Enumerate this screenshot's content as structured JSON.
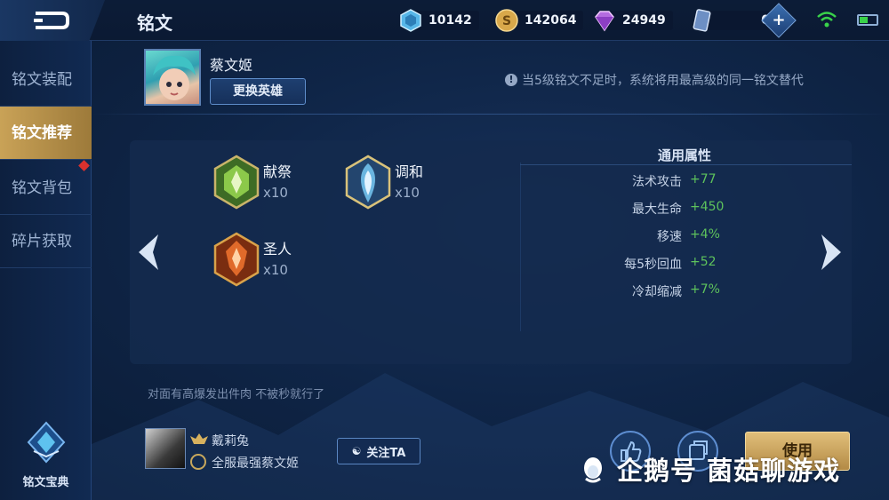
{
  "header": {
    "page_title": "铭文",
    "resources": {
      "gem": "10142",
      "coin": "142064",
      "diamond": "24949",
      "ticket": "0"
    }
  },
  "sidebar": {
    "items": [
      {
        "label": "铭文装配"
      },
      {
        "label": "铭文推荐"
      },
      {
        "label": "铭文背包"
      },
      {
        "label": "碎片获取"
      }
    ],
    "codex_label": "铭文宝典"
  },
  "hero": {
    "name": "蔡文姬",
    "change_button": "更换英雄",
    "notice": "当5级铭文不足时，系统将用最高级的同一铭文替代"
  },
  "runes": [
    {
      "name": "献祭",
      "count": "x10",
      "color": "#6fa83a"
    },
    {
      "name": "调和",
      "count": "x10",
      "color": "#c9b46a"
    },
    {
      "name": "圣人",
      "count": "x10",
      "color": "#c2561f"
    }
  ],
  "attributes": {
    "title": "通用属性",
    "rows": [
      {
        "key": "法术攻击",
        "value": "+77"
      },
      {
        "key": "最大生命",
        "value": "+450"
      },
      {
        "key": "移速",
        "value": "+4%"
      },
      {
        "key": "每5秒回血",
        "value": "+52"
      },
      {
        "key": "冷却缩减",
        "value": "+7%"
      }
    ]
  },
  "description": "对面有高爆发出件肉 不被秒就行了",
  "author": {
    "name": "戴莉兔",
    "title": "全服最强蔡文姬",
    "follow_label": "关注TA"
  },
  "actions": {
    "use_label": "使用"
  },
  "watermark": "企鹅号 菌菇聊游戏",
  "colors": {
    "accent_gold": "#c9a257",
    "value_green": "#5ec35c"
  }
}
